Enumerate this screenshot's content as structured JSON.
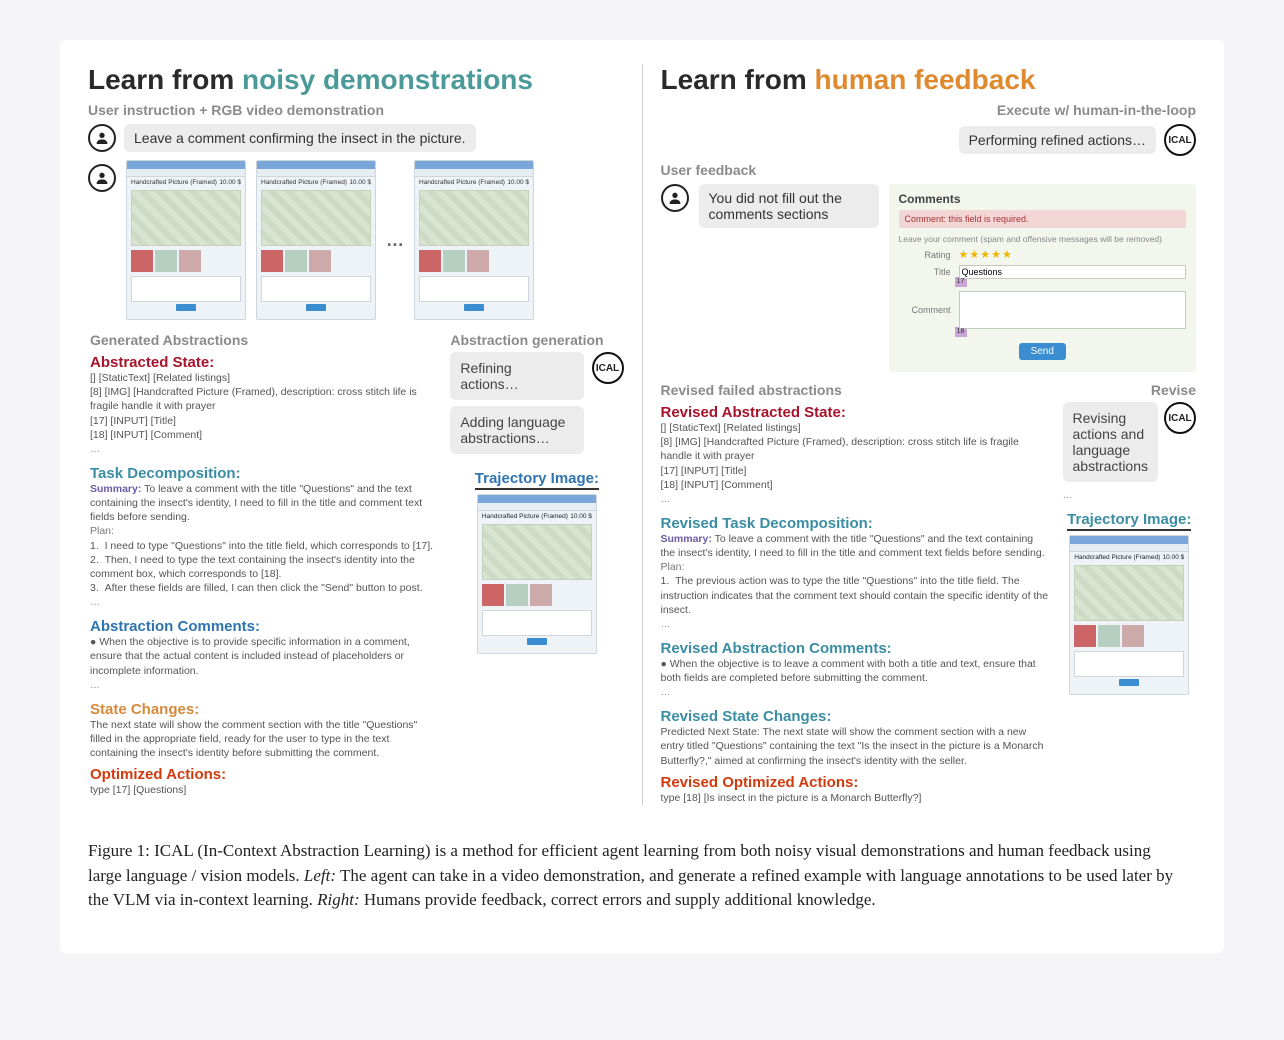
{
  "left": {
    "title_a": "Learn from ",
    "title_b": "noisy demonstrations",
    "subhead": "User instruction + RGB video demonstration",
    "instruction": "Leave a comment confirming the insect in the picture.",
    "shot_title": "Handcrafted Picture (Framed)",
    "shot_price": "10.00 $",
    "generated_head": "Generated Abstractions",
    "abstraction_gen_head": "Abstraction generation",
    "abs_state_title": "Abstracted State:",
    "abs_state_lines": [
      "[] [StaticText] [Related listings]",
      "[8] [IMG] [Handcrafted Picture (Framed), description: cross stitch life is fragile handle it with prayer",
      "[17] [INPUT] [Title]",
      "[18] [INPUT] [Comment]"
    ],
    "task_decomp_title": "Task Decomposition:",
    "task_summary_label": "Summary:",
    "task_summary": "To leave a comment with the title \"Questions\" and the text containing the insect's identity, I need to fill in the title and comment text fields before sending.",
    "plan_label": "Plan:",
    "plan": [
      "I need to type \"Questions\" into the title field, which corresponds to [17].",
      "Then, I need to type the text containing the insect's identity into the comment box, which corresponds to [18].",
      "After these fields are filled, I can then click the \"Send\" button to post."
    ],
    "abs_comments_title": "Abstraction Comments:",
    "abs_comment_bullet": "When the objective is to provide specific information in a comment, ensure that the actual content is included instead of placeholders or incomplete information.",
    "state_changes_title": "State Changes:",
    "state_changes_body": "The next state will show the comment section with the title \"Questions\" filled in the appropriate field, ready for the user to type in the text containing the insect's identity before submitting the comment.",
    "opt_actions_title": "Optimized Actions:",
    "opt_actions_body": "type [17] [Questions]",
    "refining_label": "Refining actions…",
    "adding_label": "Adding language abstractions…",
    "traj_label": "Trajectory Image:"
  },
  "right": {
    "title_a": "Learn from ",
    "title_b": "human feedback",
    "exec_subhead": "Execute w/ human-in-the-loop",
    "exec_pill": "Performing refined actions…",
    "user_feedback_head": "User feedback",
    "feedback_text": "You did not fill out the comments sections",
    "comments_panel": {
      "head": "Comments",
      "error": "Comment: this field is required.",
      "note": "Leave your comment (spam and offensive messages will be removed)",
      "rating_label": "Rating",
      "title_label": "Title",
      "title_value": "Questions",
      "title_id": "17",
      "comment_label": "Comment",
      "comment_id": "18",
      "send": "Send"
    },
    "revised_head": "Revised failed abstractions",
    "revise_head": "Revise",
    "rev_abs_state_title": "Revised Abstracted State:",
    "rev_abs_state_lines": [
      "[] [StaticText] [Related listings]",
      "[8] [IMG] [Handcrafted Picture (Framed), description: cross stitch life is fragile handle it with prayer",
      "[17] [INPUT] [Title]",
      "[18] [INPUT] [Comment]"
    ],
    "rev_task_decomp_title": "Revised Task Decomposition:",
    "rev_task_summary": "To leave a comment with the title \"Questions\" and the text containing the insect's identity, I need to fill in the title and comment text fields before sending.",
    "rev_plan_item": "The previous action was to type the title \"Questions\" into the title field. The instruction indicates that the comment text should contain the specific identity of the insect.",
    "rev_abs_comments_title": "Revised Abstraction Comments:",
    "rev_abs_comment_bullet": "When the objective is to leave a comment with both a title and text, ensure that both fields are completed before submitting the comment.",
    "rev_state_changes_title": "Revised State Changes:",
    "rev_state_changes_body": "Predicted Next State: The next state will show the comment section with a new entry titled \"Questions\" containing the text \"Is the insect in the picture is a Monarch Butterfly?,\" aimed at confirming the insect's identity with the seller.",
    "rev_opt_actions_title": "Revised Optimized Actions:",
    "rev_opt_actions_body": "type [18] [Is insect in the picture is a Monarch Butterfly?]",
    "revising_label": "Revising actions and language abstractions",
    "traj_label": "Trajectory Image:"
  },
  "caption": {
    "prefix": "Figure 1: ICAL (In-Context Abstraction Learning) is a method for efficient agent learning from both noisy visual demonstrations and human feedback using large language / vision models. ",
    "left_label": "Left:",
    "left_text": " The agent can take in a video demonstration, and generate a refined example with language annotations to be used later by the VLM via in-context learning. ",
    "right_label": "Right:",
    "right_text": " Humans provide feedback, correct errors and supply additional knowledge."
  },
  "ical_badge": "ICAL"
}
